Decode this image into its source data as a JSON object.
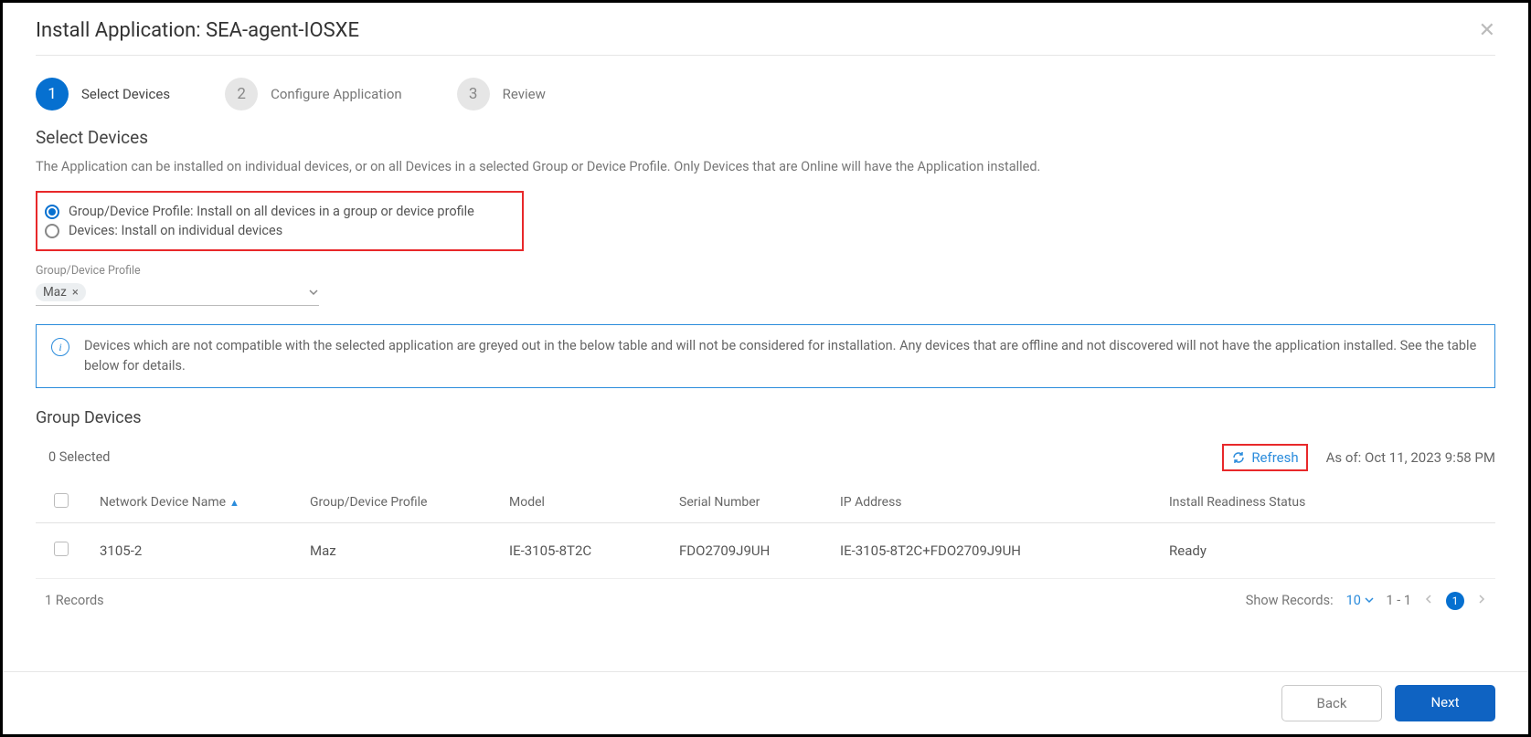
{
  "modal": {
    "title": "Install Application: SEA-agent-IOSXE"
  },
  "steps": [
    {
      "num": "1",
      "label": "Select Devices",
      "active": true
    },
    {
      "num": "2",
      "label": "Configure Application",
      "active": false
    },
    {
      "num": "3",
      "label": "Review",
      "active": false
    }
  ],
  "section": {
    "title": "Select Devices",
    "desc": "The Application can be installed on individual devices, or on all Devices in a selected Group or Device Profile. Only Devices that are Online will have the Application installed."
  },
  "radios": {
    "group_label": "Group/Device Profile: Install on all devices in a group or device profile",
    "devices_label": "Devices: Install on individual devices"
  },
  "profile_field": {
    "label": "Group/Device Profile",
    "chip": "Maz"
  },
  "info": {
    "text": "Devices which are not compatible with the selected application are greyed out in the below table and will not be considered for installation. Any devices that are offline and not discovered will not have the application installed. See the table below for details."
  },
  "groupDevices": {
    "title": "Group Devices",
    "selected": "0 Selected",
    "refresh": "Refresh",
    "asof": "As of: Oct 11, 2023 9:58 PM"
  },
  "columns": {
    "name": "Network Device Name",
    "profile": "Group/Device Profile",
    "model": "Model",
    "serial": "Serial Number",
    "ip": "IP Address",
    "status": "Install Readiness Status"
  },
  "rows": [
    {
      "name": "3105-2",
      "profile": "Maz",
      "model": "IE-3105-8T2C",
      "serial": "FDO2709J9UH",
      "ip": "IE-3105-8T2C+FDO2709J9UH",
      "status": "Ready"
    }
  ],
  "footer": {
    "records": "1 Records",
    "showRecordsLabel": "Show Records:",
    "showRecordsValue": "10",
    "range": "1 - 1",
    "page": "1"
  },
  "buttons": {
    "back": "Back",
    "next": "Next"
  }
}
